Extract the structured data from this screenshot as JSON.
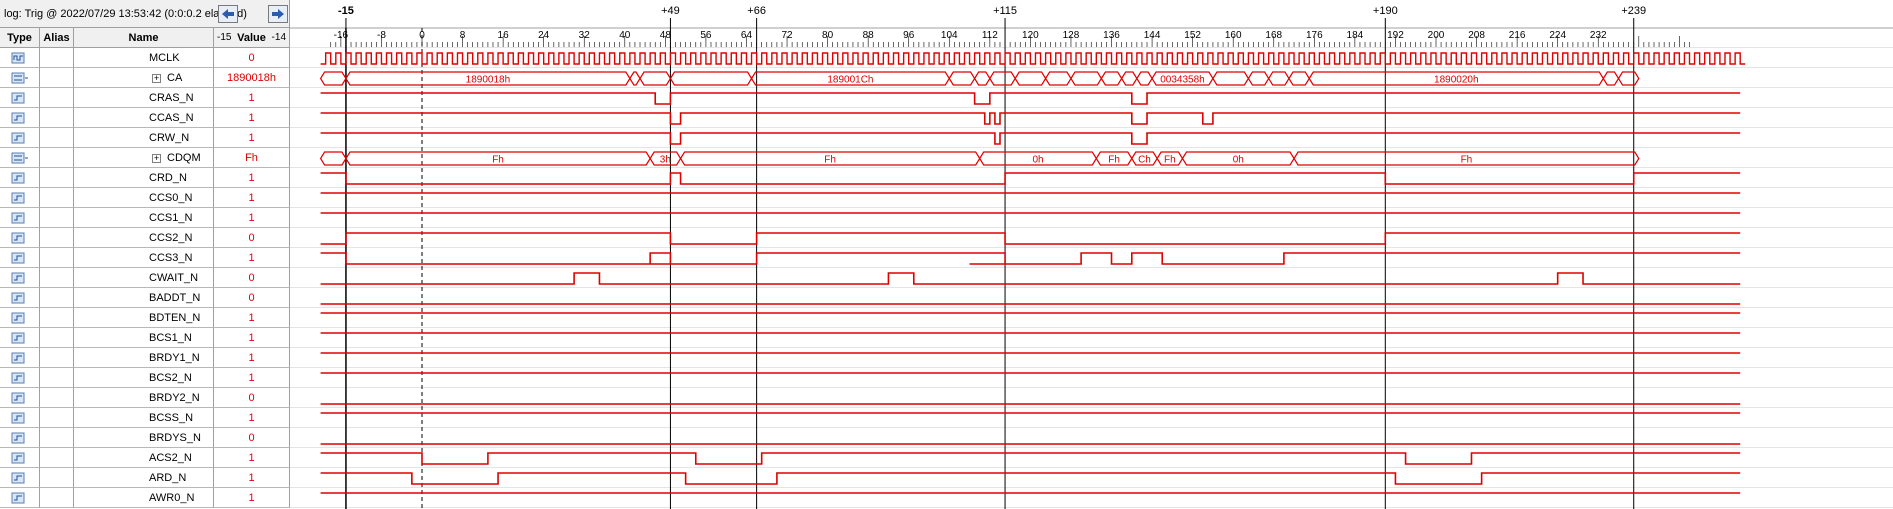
{
  "title_bar": {
    "log_label": "log: Trig @ 2022/07/29 13:53:42 (0:0:0.2 elapsed)"
  },
  "columns": {
    "type": "Type",
    "alias": "Alias",
    "name": "Name",
    "value": "Value"
  },
  "value_header": {
    "left_tick": "-15",
    "right_tick": "-14"
  },
  "colors": {
    "waveform": "#e00000",
    "cursor": "#000000",
    "marker": "#000000"
  },
  "ruler": {
    "top_markers": [
      "-15",
      "+49",
      "+66",
      "+115",
      "+190",
      "+239"
    ],
    "ticks": [
      "-16",
      "-8",
      "0",
      "8",
      "16",
      "24",
      "32",
      "40",
      "48",
      "56",
      "64",
      "72",
      "80",
      "88",
      "96",
      "104",
      "112",
      "120",
      "128",
      "136",
      "144",
      "152",
      "160",
      "168",
      "176",
      "184",
      "192",
      "200",
      "208",
      "216",
      "224",
      "232"
    ]
  },
  "signals": [
    {
      "name": "MCLK",
      "value": "0",
      "type_icon": "clock-signal-icon",
      "group": false
    },
    {
      "name": "CA",
      "value": "1890018h",
      "type_icon": "bus-signal-icon",
      "group": true,
      "bus_labels": [
        "1890018h",
        "189001Ch",
        "0034358h",
        "1890020h"
      ]
    },
    {
      "name": "CRAS_N",
      "value": "1",
      "type_icon": "bit-signal-icon",
      "group": false
    },
    {
      "name": "CCAS_N",
      "value": "1",
      "type_icon": "bit-signal-icon",
      "group": false
    },
    {
      "name": "CRW_N",
      "value": "1",
      "type_icon": "bit-signal-icon",
      "group": false
    },
    {
      "name": "CDQM",
      "value": "Fh",
      "type_icon": "bus-signal-icon",
      "group": true,
      "bus_labels": [
        "Fh",
        "3h",
        "Fh",
        "0h",
        "Fh",
        "Ch",
        "Fh",
        "0h",
        "Fh"
      ]
    },
    {
      "name": "CRD_N",
      "value": "1",
      "type_icon": "bit-signal-icon",
      "group": false
    },
    {
      "name": "CCS0_N",
      "value": "1",
      "type_icon": "bit-signal-icon",
      "group": false
    },
    {
      "name": "CCS1_N",
      "value": "1",
      "type_icon": "bit-signal-icon",
      "group": false
    },
    {
      "name": "CCS2_N",
      "value": "0",
      "type_icon": "bit-signal-icon",
      "group": false
    },
    {
      "name": "CCS3_N",
      "value": "1",
      "type_icon": "bit-signal-icon",
      "group": false
    },
    {
      "name": "CWAIT_N",
      "value": "0",
      "type_icon": "bit-signal-icon",
      "group": false
    },
    {
      "name": "BADDT_N",
      "value": "0",
      "type_icon": "bit-signal-icon",
      "group": false
    },
    {
      "name": "BDTEN_N",
      "value": "1",
      "type_icon": "bit-signal-icon",
      "group": false
    },
    {
      "name": "BCS1_N",
      "value": "1",
      "type_icon": "bit-signal-icon",
      "group": false
    },
    {
      "name": "BRDY1_N",
      "value": "1",
      "type_icon": "bit-signal-icon",
      "group": false
    },
    {
      "name": "BCS2_N",
      "value": "1",
      "type_icon": "bit-signal-icon",
      "group": false
    },
    {
      "name": "BRDY2_N",
      "value": "0",
      "type_icon": "bit-signal-icon",
      "group": false
    },
    {
      "name": "BCSS_N",
      "value": "1",
      "type_icon": "bit-signal-icon",
      "group": false
    },
    {
      "name": "BRDYS_N",
      "value": "0",
      "type_icon": "bit-signal-icon",
      "group": false
    },
    {
      "name": "ACS2_N",
      "value": "1",
      "type_icon": "bit-signal-icon",
      "group": false
    },
    {
      "name": "ARD_N",
      "value": "1",
      "type_icon": "bit-signal-icon",
      "group": false
    },
    {
      "name": "AWR0_N",
      "value": "1",
      "type_icon": "bit-signal-icon",
      "group": false
    }
  ]
}
